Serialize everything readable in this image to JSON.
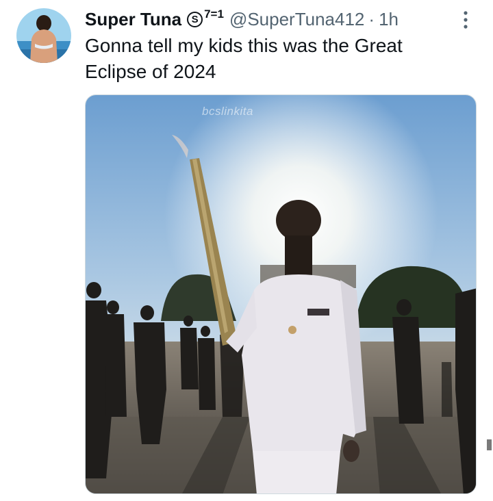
{
  "tweet": {
    "display_name": "Super Tuna",
    "badge_symbol": "S",
    "badge_suffix": "7=1",
    "handle": "@SuperTuna412",
    "separator": "·",
    "time": "1h",
    "text": "Gonna tell my kids this was the Great\nEclipse of 2024",
    "media": {
      "watermark": "bcslinkita"
    }
  },
  "icons": {
    "more": "vertical-ellipsis-icon",
    "avatar": "profile-photo"
  },
  "colors": {
    "primary_text": "#0f1419",
    "secondary_text": "#536471",
    "media_border": "#cfd9de"
  }
}
